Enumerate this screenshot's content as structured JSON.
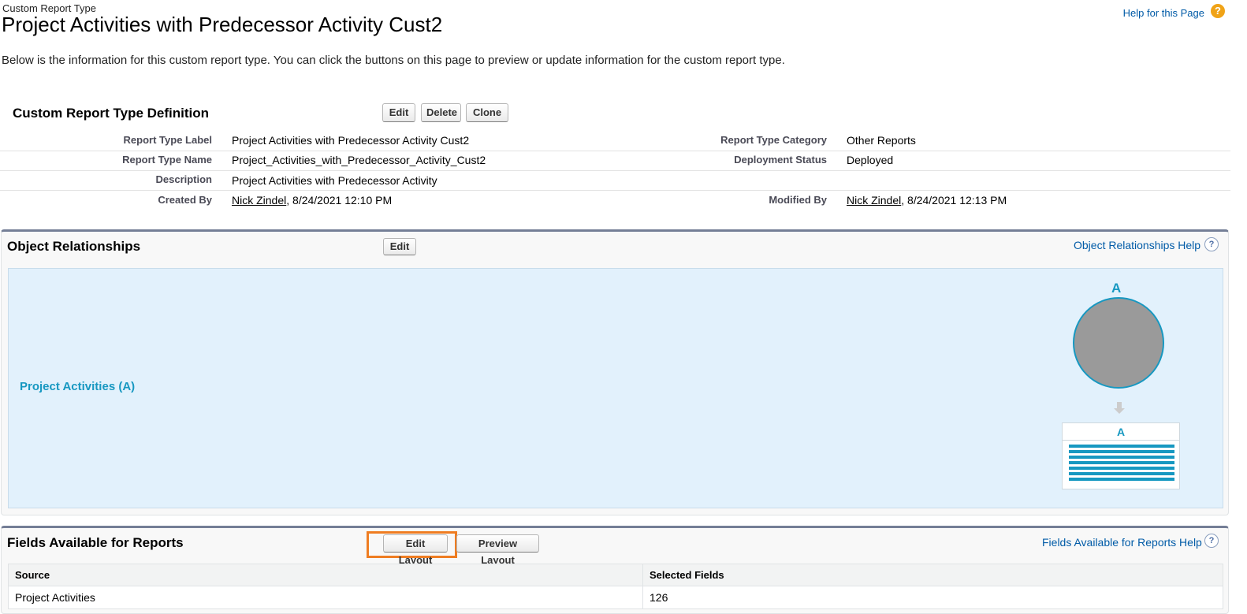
{
  "header": {
    "subtitle": "Custom Report Type",
    "title": "Project Activities with Predecessor Activity Cust2",
    "help_link": "Help for this Page",
    "help_icon": "?",
    "intro": "Below is the information for this custom report type. You can click the buttons on this page to preview or update information for the custom report type."
  },
  "definition": {
    "title": "Custom Report Type Definition",
    "buttons": {
      "edit": "Edit",
      "delete": "Delete",
      "clone": "Clone"
    },
    "fields": {
      "report_type_label": {
        "label": "Report Type Label",
        "value": "Project Activities with Predecessor Activity Cust2"
      },
      "report_type_name": {
        "label": "Report Type Name",
        "value": "Project_Activities_with_Predecessor_Activity_Cust2"
      },
      "description": {
        "label": "Description",
        "value": "Project Activities with Predecessor Activity"
      },
      "created_by": {
        "label": "Created By",
        "user": "Nick Zindel",
        "date": ", 8/24/2021 12:10 PM"
      },
      "report_type_category": {
        "label": "Report Type Category",
        "value": "Other Reports"
      },
      "deployment_status": {
        "label": "Deployment Status",
        "value": "Deployed"
      },
      "modified_by": {
        "label": "Modified By",
        "user": "Nick Zindel",
        "date": ", 8/24/2021 12:13 PM"
      }
    }
  },
  "object_relationships": {
    "title": "Object Relationships",
    "edit_button": "Edit",
    "help_link": "Object Relationships Help",
    "help_icon": "?",
    "primary_object": "Project Activities (A)",
    "diagram_letter_top": "A",
    "diagram_letter_box": "A"
  },
  "fields_available": {
    "title": "Fields Available for Reports",
    "edit_layout_button": "Edit Layout",
    "preview_layout_button": "Preview Layout",
    "help_link": "Fields Available for Reports Help",
    "help_icon": "?",
    "columns": {
      "source": "Source",
      "selected_fields": "Selected Fields"
    },
    "rows": [
      {
        "source": "Project Activities",
        "selected_fields": "126"
      }
    ]
  },
  "colors": {
    "link": "#015ba7",
    "relationship_bg": "#e2f1fc",
    "accent_blue": "#1798c1",
    "highlight": "#ef7d22",
    "circle_fill": "#9a9a9a"
  }
}
